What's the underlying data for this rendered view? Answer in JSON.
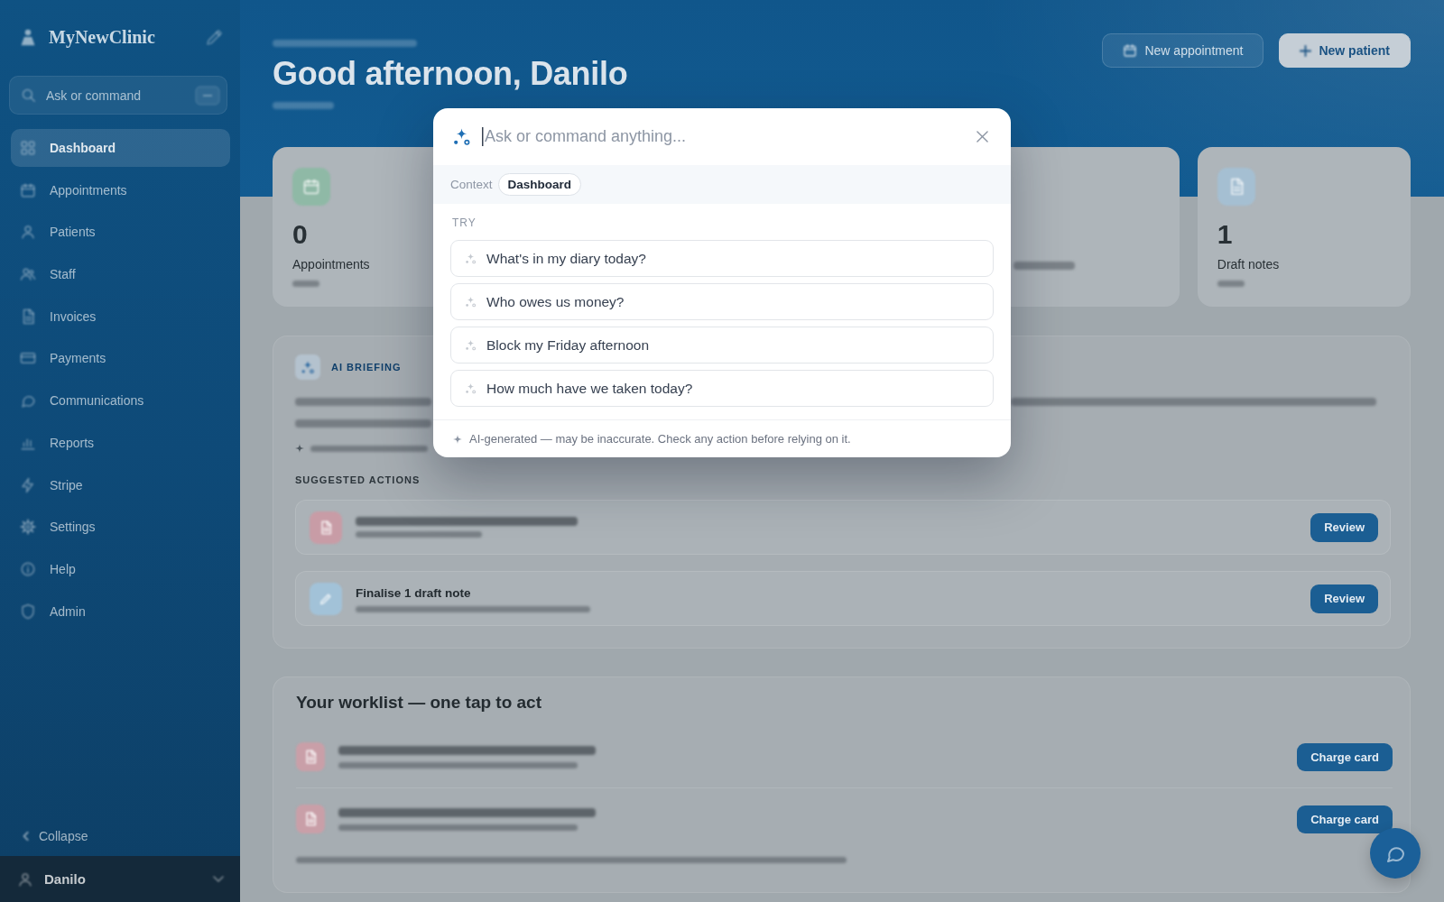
{
  "sidebar": {
    "brand": "MyNewClinic",
    "search": {
      "placeholder": "Ask or command"
    },
    "items": [
      {
        "label": "Dashboard",
        "selected": true
      },
      {
        "label": "Appointments",
        "selected": false
      },
      {
        "label": "Patients",
        "selected": false
      },
      {
        "label": "Staff",
        "selected": false
      },
      {
        "label": "Invoices",
        "selected": false
      },
      {
        "label": "Payments",
        "selected": false
      },
      {
        "label": "Communications",
        "selected": false
      },
      {
        "label": "Reports",
        "selected": false
      },
      {
        "label": "Stripe",
        "selected": false
      },
      {
        "label": "Settings",
        "selected": false
      },
      {
        "label": "Help",
        "selected": false
      },
      {
        "label": "Admin",
        "selected": false
      }
    ],
    "collapse": "Collapse",
    "user": "Danilo"
  },
  "header": {
    "greeting": "Good afternoon, Danilo",
    "actions": [
      {
        "label": "New appointment",
        "kind": "secondary"
      },
      {
        "label": "New patient",
        "kind": "primary"
      }
    ]
  },
  "stats": [
    {
      "value": "0",
      "label": "Appointments",
      "color": "#8fb9a6"
    },
    {
      "value": "1",
      "label": "Draft notes",
      "color": "#a5bfd2"
    }
  ],
  "briefing": {
    "label": "AI BRIEFING",
    "section": "SUGGESTED ACTIONS",
    "actions": [
      {
        "color": "#c89ca6",
        "button": "Review"
      },
      {
        "title": "Finalise 1 draft note",
        "color": "#a2c2d8",
        "button": "Review"
      }
    ]
  },
  "worklist": {
    "title": "Your worklist — one tap to act",
    "rows": [
      {
        "button": "Charge card"
      },
      {
        "button": "Charge card"
      }
    ]
  },
  "command_palette": {
    "placeholder": "Ask or command anything...",
    "context": {
      "label": "Context",
      "chip": "Dashboard"
    },
    "section": "TRY",
    "suggestions": [
      "What's in my diary today?",
      "Who owes us money?",
      "Block my Friday afternoon",
      "How much have we taken today?"
    ],
    "disclaimer": "AI-generated — may be inaccurate. Check any action before relying on it."
  }
}
